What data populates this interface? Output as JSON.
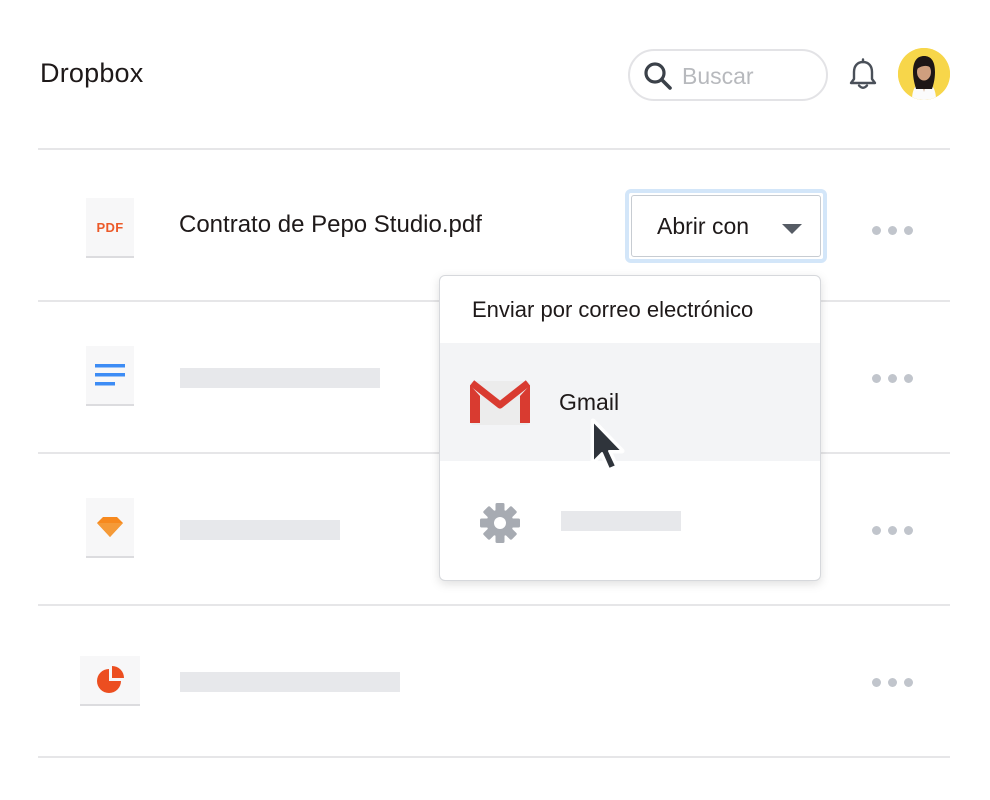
{
  "header": {
    "title": "Dropbox",
    "search_placeholder": "Buscar"
  },
  "files": [
    {
      "icon": "pdf-file-icon",
      "type_label": "PDF",
      "name": "Contrato de Pepo Studio.pdf"
    },
    {
      "icon": "document-file-icon"
    },
    {
      "icon": "sketch-file-icon"
    },
    {
      "icon": "presentation-file-icon"
    }
  ],
  "open_with": {
    "label": "Abrir con",
    "menu_header": "Enviar por correo electrónico",
    "items": [
      {
        "label": "Gmail",
        "icon": "gmail-icon",
        "highlighted": true
      },
      {
        "icon": "gear-icon"
      }
    ]
  },
  "colors": {
    "accent_orange": "#F7891E",
    "pdf_red": "#EC5A29",
    "doc_blue": "#3D8CF5",
    "gmail_red": "#D93B30",
    "focus_ring": "#D3E6F9"
  }
}
